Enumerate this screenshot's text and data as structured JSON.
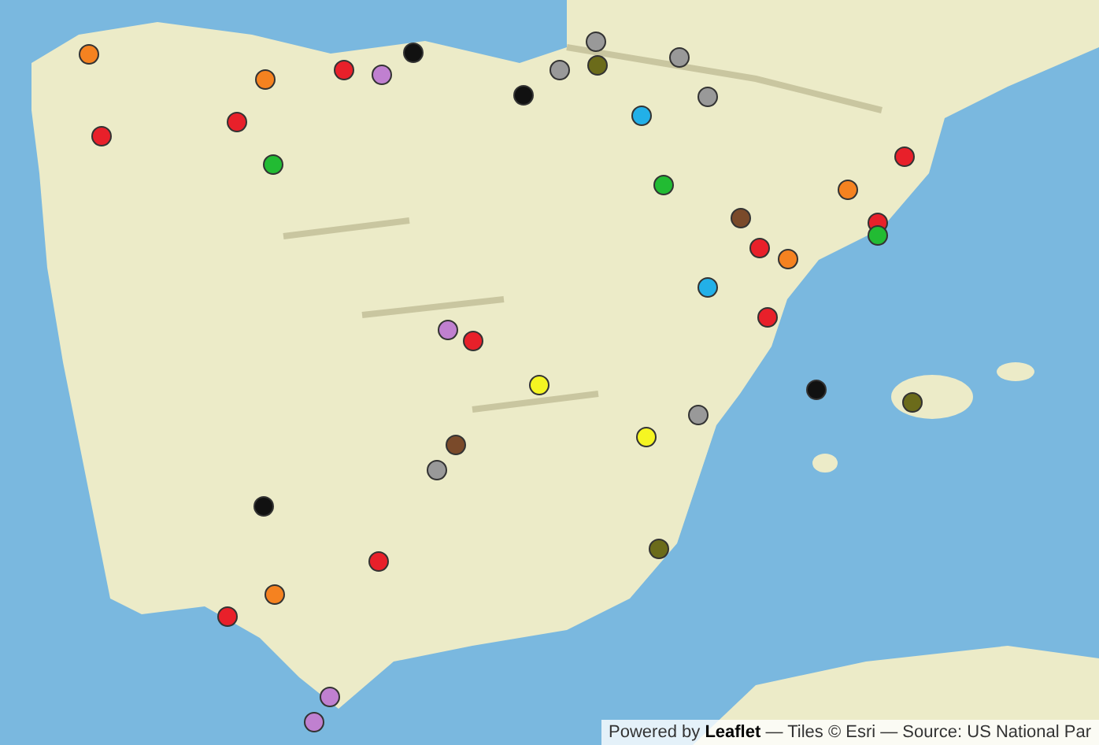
{
  "map": {
    "markers": [
      {
        "color": "#f58220"
      },
      {
        "color": "#f58220"
      },
      {
        "color": "#e8202a"
      },
      {
        "color": "#c080d0"
      },
      {
        "color": "#111111"
      },
      {
        "color": "#999999"
      },
      {
        "color": "#999999"
      },
      {
        "color": "#6b6b1a"
      },
      {
        "color": "#999999"
      },
      {
        "color": "#111111"
      },
      {
        "color": "#999999"
      },
      {
        "color": "#22b0e8"
      },
      {
        "color": "#e8202a"
      },
      {
        "color": "#e8202a"
      },
      {
        "color": "#22bb33"
      },
      {
        "color": "#e8202a"
      },
      {
        "color": "#22bb33"
      },
      {
        "color": "#f58220"
      },
      {
        "color": "#7a4a2a"
      },
      {
        "color": "#e8202a"
      },
      {
        "color": "#22bb33"
      },
      {
        "color": "#e8202a"
      },
      {
        "color": "#f58220"
      },
      {
        "color": "#22b0e8"
      },
      {
        "color": "#e8202a"
      },
      {
        "color": "#c080d0"
      },
      {
        "color": "#e8202a"
      },
      {
        "color": "#f5f522"
      },
      {
        "color": "#111111"
      },
      {
        "color": "#6b6b1a"
      },
      {
        "color": "#999999"
      },
      {
        "color": "#f5f522"
      },
      {
        "color": "#7a4a2a"
      },
      {
        "color": "#999999"
      },
      {
        "color": "#111111"
      },
      {
        "color": "#6b6b1a"
      },
      {
        "color": "#e8202a"
      },
      {
        "color": "#f58220"
      },
      {
        "color": "#e8202a"
      },
      {
        "color": "#c080d0"
      },
      {
        "color": "#c080d0"
      }
    ]
  },
  "attribution": "Powered by **Leaflet** — Tiles © Esri — Source: US National Par"
}
